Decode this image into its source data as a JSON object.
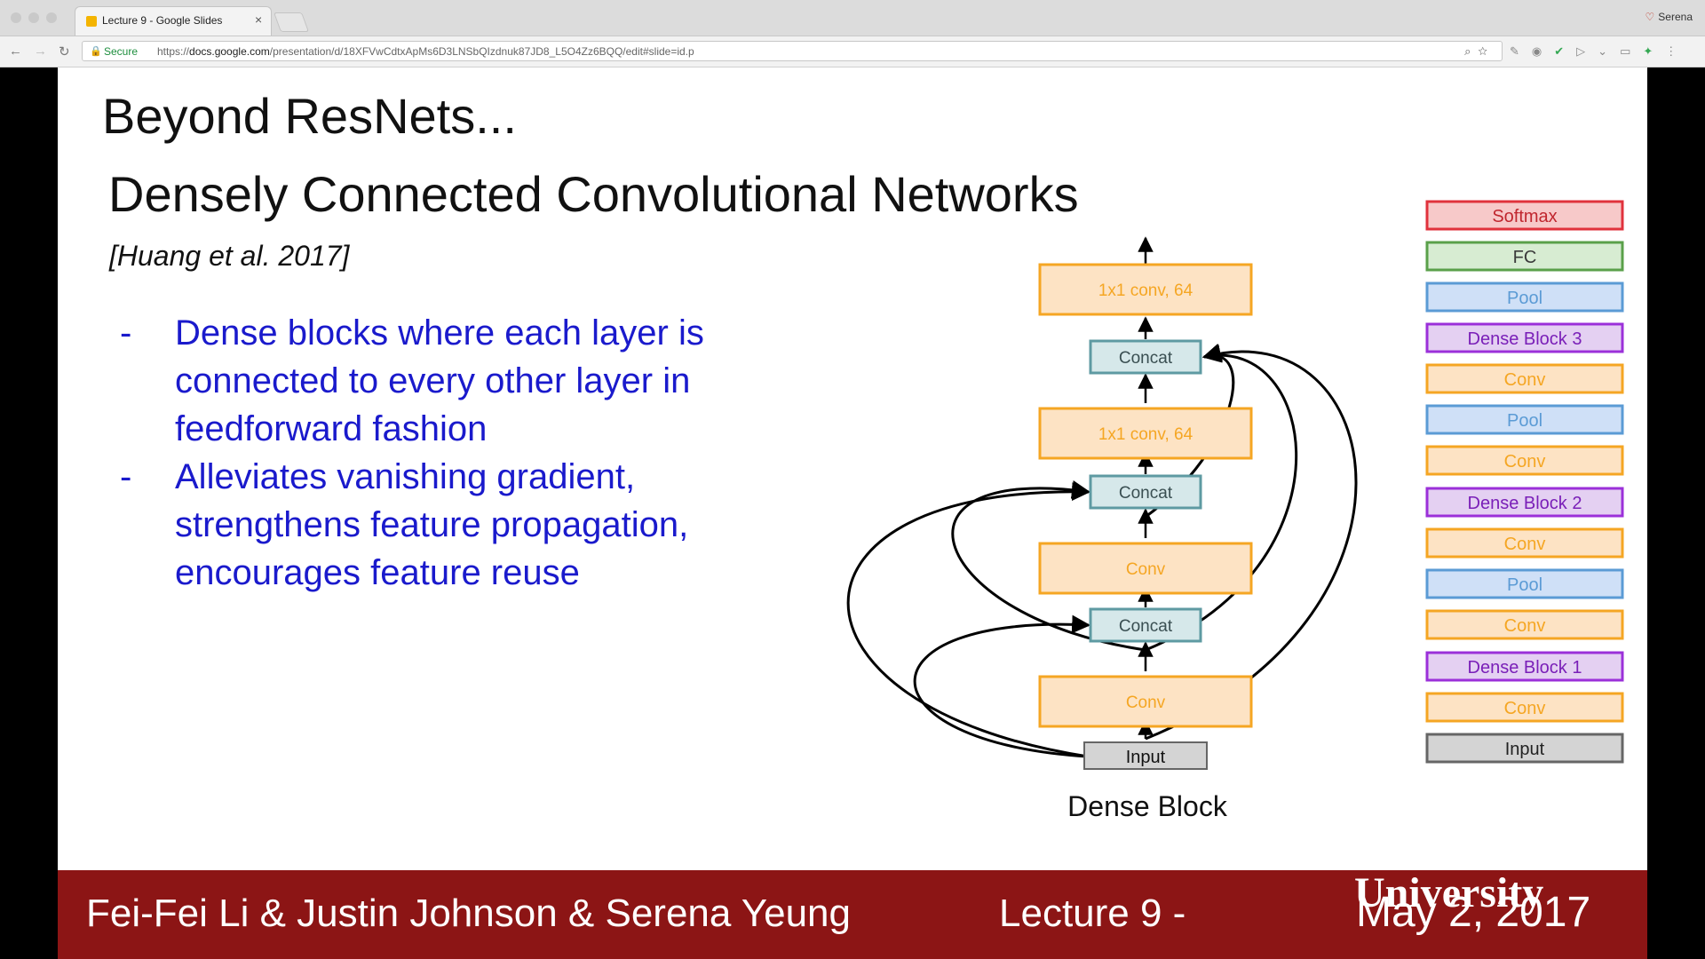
{
  "browser": {
    "tab_title": "Lecture 9 - Google Slides",
    "tab_close": "×",
    "profile_name": "Serena",
    "secure_label": "Secure",
    "url_scheme": "https://",
    "url_host": "docs.google.com",
    "url_path": "/presentation/d/18XFVwCdtxApMs6D3LNSbQIzdnuk87JD8_L5O4Zz6BQQ/edit#slide=id.p"
  },
  "slide": {
    "title": "Beyond ResNets...",
    "subtitle": "Densely Connected Convolutional Networks",
    "citation": "[Huang et al. 2017]",
    "bullets": [
      "Dense blocks where each layer is connected to every other layer in feedforward fashion",
      "Alleviates vanishing gradient, strengthens feature propagation, encourages feature reuse"
    ],
    "bullet_marker": "-",
    "dense_block": {
      "caption": "Dense Block",
      "layers": [
        "Input",
        "Conv",
        "Concat",
        "Conv",
        "Concat",
        "1x1 conv, 64",
        "Concat",
        "1x1 conv, 64"
      ]
    },
    "architecture": [
      {
        "label": "Softmax",
        "kind": "softmax"
      },
      {
        "label": "FC",
        "kind": "fc"
      },
      {
        "label": "Pool",
        "kind": "pool"
      },
      {
        "label": "Dense Block 3",
        "kind": "dense"
      },
      {
        "label": "Conv",
        "kind": "conv"
      },
      {
        "label": "Pool",
        "kind": "pool"
      },
      {
        "label": "Conv",
        "kind": "conv"
      },
      {
        "label": "Dense Block 2",
        "kind": "dense"
      },
      {
        "label": "Conv",
        "kind": "conv"
      },
      {
        "label": "Pool",
        "kind": "pool"
      },
      {
        "label": "Conv",
        "kind": "conv"
      },
      {
        "label": "Dense Block 1",
        "kind": "dense"
      },
      {
        "label": "Conv",
        "kind": "conv"
      },
      {
        "label": "Input",
        "kind": "input"
      }
    ],
    "footer": {
      "authors": "Fei-Fei Li & Justin Johnson & Serena Yeung",
      "lecture": "Lecture 9 -",
      "university": "University",
      "date": "May 2, 2017"
    }
  },
  "colors": {
    "bullet_text": "#1a1acc",
    "footer_bg": "#8c1515",
    "conv_fill": "#fde3c4",
    "conv_stroke": "#f5a623",
    "conv_text": "#f5a623",
    "concat_fill": "#d6e8ea",
    "concat_stroke": "#5e9aa2",
    "concat_text": "#3a4f52",
    "input_fill": "#d4d4d4",
    "input_stroke": "#666666",
    "softmax_fill": "#f7c9c9",
    "softmax_stroke": "#e0323c",
    "softmax_text": "#c0262e",
    "fc_fill": "#d7ecd2",
    "fc_stroke": "#5aa04a",
    "pool_fill": "#cfe0f7",
    "pool_stroke": "#5b9bd5",
    "pool_text": "#5b9bd5",
    "dense_fill": "#e4d0f2",
    "dense_stroke": "#9b30d9",
    "dense_text": "#7a1fb8"
  }
}
